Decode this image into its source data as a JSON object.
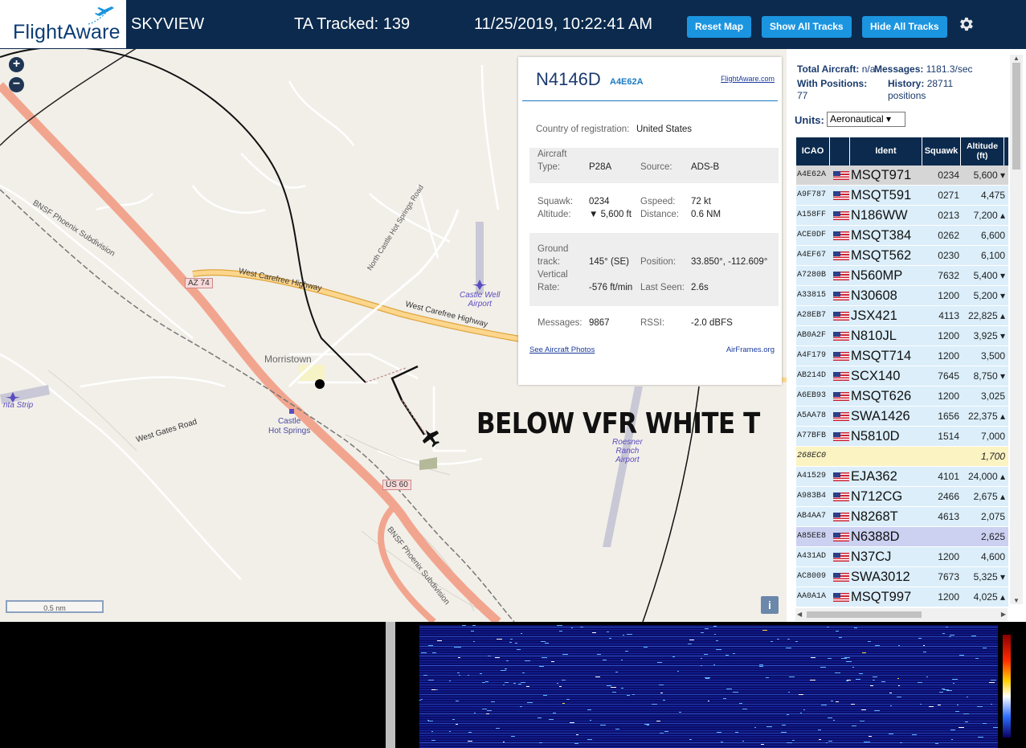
{
  "header": {
    "logo_text": "FlightAware",
    "app_title": "SKYVIEW",
    "tracked": "TA Tracked: 139",
    "datetime": "11/25/2019, 10:22:41 AM",
    "buttons": {
      "reset": "Reset Map",
      "show": "Show All Tracks",
      "hide": "Hide All Tracks"
    },
    "settings_icon": "gear-icon"
  },
  "map": {
    "zoom_in": "+",
    "zoom_out": "−",
    "scale": "0.5 nm",
    "info": "i",
    "labels": {
      "bnsf1": "BNSF Phoenix Subdivision",
      "bnsf2": "BNSF Phoenix Subdivision",
      "az74": "AZ 74",
      "wch1": "West Carefree Highway",
      "wch2": "West Carefree Highway",
      "nchs": "North Castle Hot Springs Road",
      "morristown": "Morristown",
      "castle_hs": "Castle\nHot Springs",
      "wgr": "West Gates Road",
      "us60": "US 60",
      "castlewell": "Castle Well\nAirport",
      "roesner": "Roesner\nRanch\nAirport",
      "strip": "nta Strip"
    },
    "overlay_text": "BELOW VFR WHITE T"
  },
  "popup": {
    "callsign": "N4146D",
    "hex": "A4E62A",
    "fa_link": "FlightAware.com",
    "country_label": "Country of registration:",
    "country": "United States",
    "aircraft_label": "Aircraft",
    "type_label": "Type:",
    "type": "P28A",
    "source_label": "Source:",
    "source": "ADS-B",
    "squawk_label": "Squawk:",
    "squawk": "0234",
    "gspeed_label": "Gspeed:",
    "gspeed": "72 kt",
    "altitude_label": "Altitude:",
    "altitude": "▼ 5,600 ft",
    "distance_label": "Distance:",
    "distance": "0.6 NM",
    "ground_label": "Ground",
    "track_label": "track:",
    "track": "145° (SE)",
    "position_label": "Position:",
    "position": "33.850°, -112.609°",
    "vertical_label": "Vertical",
    "rate_label": "Rate:",
    "rate": "-576 ft/min",
    "lastseen_label": "Last Seen:",
    "lastseen": "2.6s",
    "messages_label": "Messages:",
    "messages": "9867",
    "rssi_label": "RSSI:",
    "rssi": "-2.0 dBFS",
    "photos_link": "See Aircraft Photos",
    "airframes_link": "AirFrames.org"
  },
  "stats": {
    "total_label": "Total Aircraft:",
    "total": "n/a",
    "messages_label": "Messages:",
    "messages": "1181.3/sec",
    "withpos_label": "With Positions:",
    "withpos": "77",
    "history_label": "History:",
    "history": "28711",
    "history_unit": "positions",
    "units_label": "Units:",
    "units_value": "Aeronautical ▾"
  },
  "table": {
    "headers": [
      "ICAO",
      "",
      "Ident",
      "Squawk",
      "Altitude\n(ft)"
    ],
    "rows": [
      {
        "icao": "A4E62A",
        "ident": "MSQT971",
        "squawk": "0234",
        "alt": "5,600 ▾",
        "state": "sel"
      },
      {
        "icao": "A9F787",
        "ident": "MSQT591",
        "squawk": "0271",
        "alt": "4,475",
        "state": ""
      },
      {
        "icao": "A158FF",
        "ident": "N186WW",
        "squawk": "0213",
        "alt": "7,200 ▴",
        "state": ""
      },
      {
        "icao": "ACE0DF",
        "ident": "MSQT384",
        "squawk": "0262",
        "alt": "6,600",
        "state": ""
      },
      {
        "icao": "A4EF67",
        "ident": "MSQT562",
        "squawk": "0230",
        "alt": "6,100",
        "state": ""
      },
      {
        "icao": "A7280B",
        "ident": "N560MP",
        "squawk": "7632",
        "alt": "5,400 ▾",
        "state": ""
      },
      {
        "icao": "A33815",
        "ident": "N30608",
        "squawk": "1200",
        "alt": "5,200 ▾",
        "state": ""
      },
      {
        "icao": "A28EB7",
        "ident": "JSX421",
        "squawk": "4113",
        "alt": "22,825 ▴",
        "state": ""
      },
      {
        "icao": "AB0A2F",
        "ident": "N810JL",
        "squawk": "1200",
        "alt": "3,925 ▾",
        "state": ""
      },
      {
        "icao": "A4F179",
        "ident": "MSQT714",
        "squawk": "1200",
        "alt": "3,500",
        "state": ""
      },
      {
        "icao": "AB214D",
        "ident": "SCX140",
        "squawk": "7645",
        "alt": "8,750 ▾",
        "state": ""
      },
      {
        "icao": "A6EB93",
        "ident": "MSQT626",
        "squawk": "1200",
        "alt": "3,025",
        "state": ""
      },
      {
        "icao": "A5AA78",
        "ident": "SWA1426",
        "squawk": "1656",
        "alt": "22,375 ▴",
        "state": ""
      },
      {
        "icao": "A77BFB",
        "ident": "N5810D",
        "squawk": "1514",
        "alt": "7,000",
        "state": ""
      },
      {
        "icao": "268EC0",
        "ident": "",
        "squawk": "",
        "alt": "1,700",
        "state": "hl",
        "noflag": true
      },
      {
        "icao": "A41529",
        "ident": "EJA362",
        "squawk": "4101",
        "alt": "24,000 ▴",
        "state": ""
      },
      {
        "icao": "A983B4",
        "ident": "N712CG",
        "squawk": "2466",
        "alt": "2,675 ▴",
        "state": ""
      },
      {
        "icao": "AB4AA7",
        "ident": "N8268T",
        "squawk": "4613",
        "alt": "2,075",
        "state": ""
      },
      {
        "icao": "A85EE8",
        "ident": "N6388D",
        "squawk": "",
        "alt": "2,625",
        "state": "hl2"
      },
      {
        "icao": "A431AD",
        "ident": "N37CJ",
        "squawk": "1200",
        "alt": "4,600",
        "state": ""
      },
      {
        "icao": "AC8009",
        "ident": "SWA3012",
        "squawk": "7673",
        "alt": "5,325 ▾",
        "state": ""
      },
      {
        "icao": "AA0A1A",
        "ident": "MSQT997",
        "squawk": "1200",
        "alt": "4,025 ▴",
        "state": ""
      }
    ]
  },
  "colors": {
    "header_bg": "#0b2a4d",
    "button": "#1b95e0",
    "map_bg": "#f2efe9",
    "highway": "#f2a58e",
    "row": "#dbeefa",
    "row_selected": "#d6d6d6",
    "row_highlight": "#fbf3c2"
  }
}
